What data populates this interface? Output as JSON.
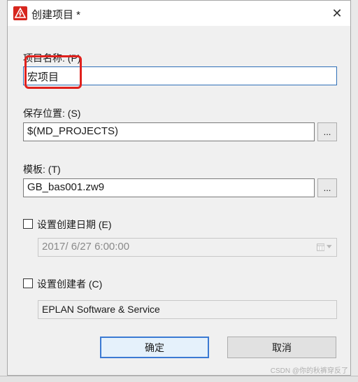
{
  "window": {
    "title": "创建项目 *",
    "close_glyph": "✕"
  },
  "project_name": {
    "label": "项目名称: (P)",
    "value": "宏项目"
  },
  "save_location": {
    "label": "保存位置: (S)",
    "value": "$(MD_PROJECTS)",
    "browse": "..."
  },
  "template": {
    "label": "模板: (T)",
    "value": "GB_bas001.zw9",
    "browse": "..."
  },
  "creation_date": {
    "label": "设置创建日期 (E)",
    "checked": false,
    "value": "2017/  6/27   6:00:00"
  },
  "creator": {
    "label": "设置创建者 (C)",
    "checked": false,
    "value": "EPLAN Software & Service"
  },
  "buttons": {
    "ok": "确定",
    "cancel": "取消"
  },
  "watermark": "CSDN @你的秋裤穿反了",
  "colors": {
    "highlight": "#e0211d",
    "focus_border": "#2f6fb7",
    "app_icon": "#d7261e"
  },
  "icons": {
    "app": "eplan-warning-icon",
    "close": "close-icon",
    "calendar": "calendar-icon",
    "dropdown": "chevron-down-icon"
  }
}
